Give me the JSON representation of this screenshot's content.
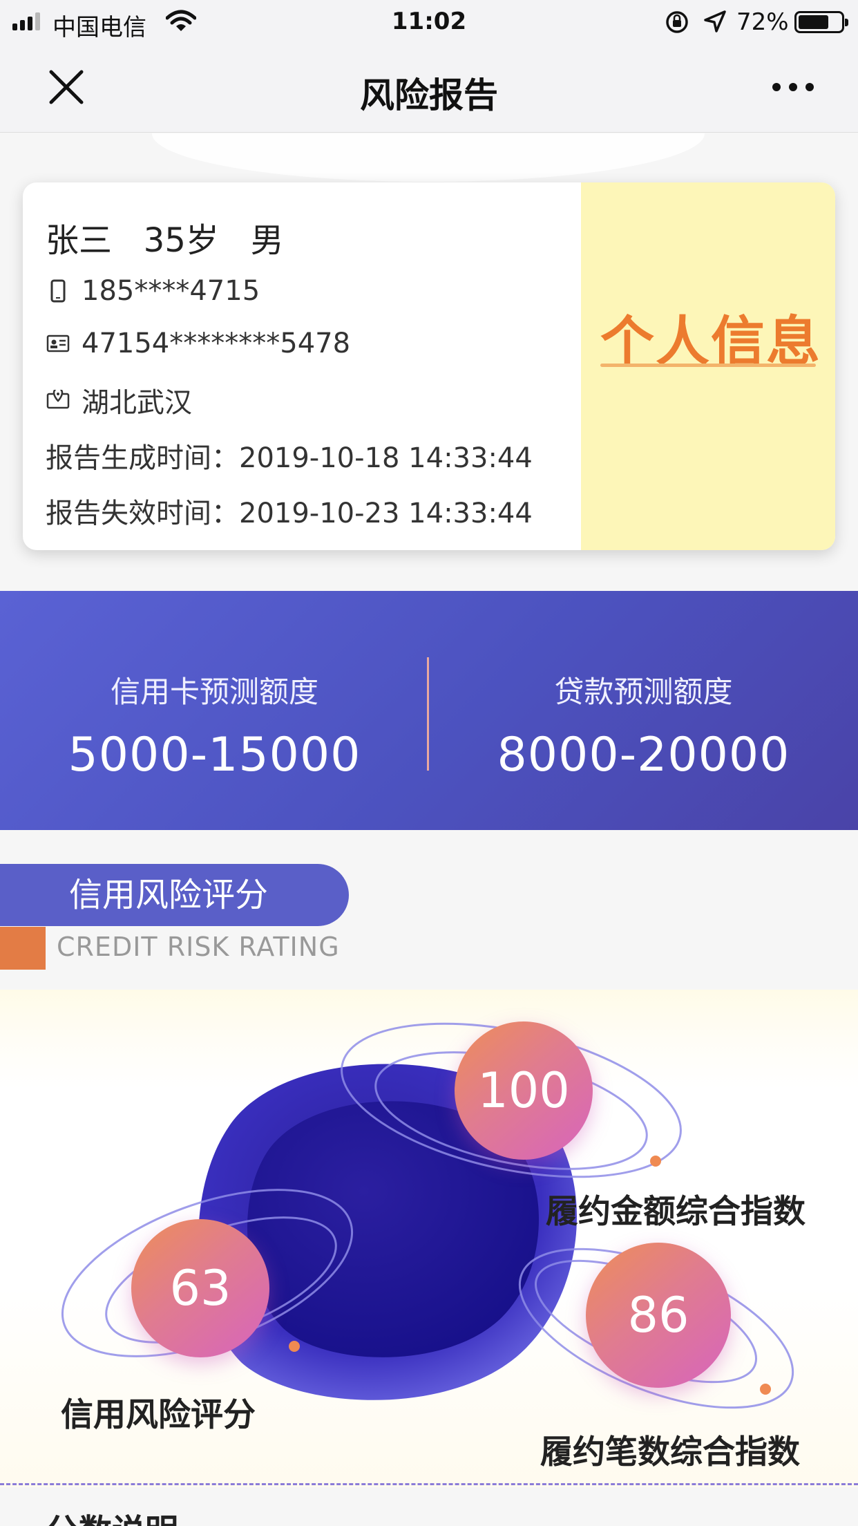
{
  "status_bar": {
    "carrier": "中国电信",
    "time": "11:02",
    "battery": "72%",
    "battery_level": 0.72
  },
  "nav": {
    "title": "风险报告",
    "close_icon": "close-icon",
    "more_icon": "more-icon"
  },
  "profile": {
    "name_line": "张三   35岁   男",
    "phone": "185****4715",
    "id_number": "47154********5478",
    "location": "湖北武汉",
    "generated_label": "报告生成时间：",
    "generated_time": "2019-10-18 14:33:44",
    "expire_label": "报告失效时间：",
    "expire_time": "2019-10-23 14:33:44",
    "side_title": "个人信息"
  },
  "credit": {
    "card_label": "信用卡预测额度",
    "card_value": "5000-15000",
    "loan_label": "贷款预测额度",
    "loan_value": "8000-20000"
  },
  "section": {
    "title_cn": "信用风险评分",
    "title_en": "CREDIT RISK RATING"
  },
  "scores": {
    "amount_index": {
      "value": "100",
      "label": "履约金额综合指数"
    },
    "risk_score": {
      "value": "63",
      "label": "信用风险评分"
    },
    "count_index": {
      "value": "86",
      "label": "履约笔数综合指数"
    }
  },
  "next_section_title": "分数说明",
  "colors": {
    "accent_blue": "#5a5fc8",
    "accent_orange": "#ec7b2e",
    "card_side_bg": "#fdf6b8"
  }
}
